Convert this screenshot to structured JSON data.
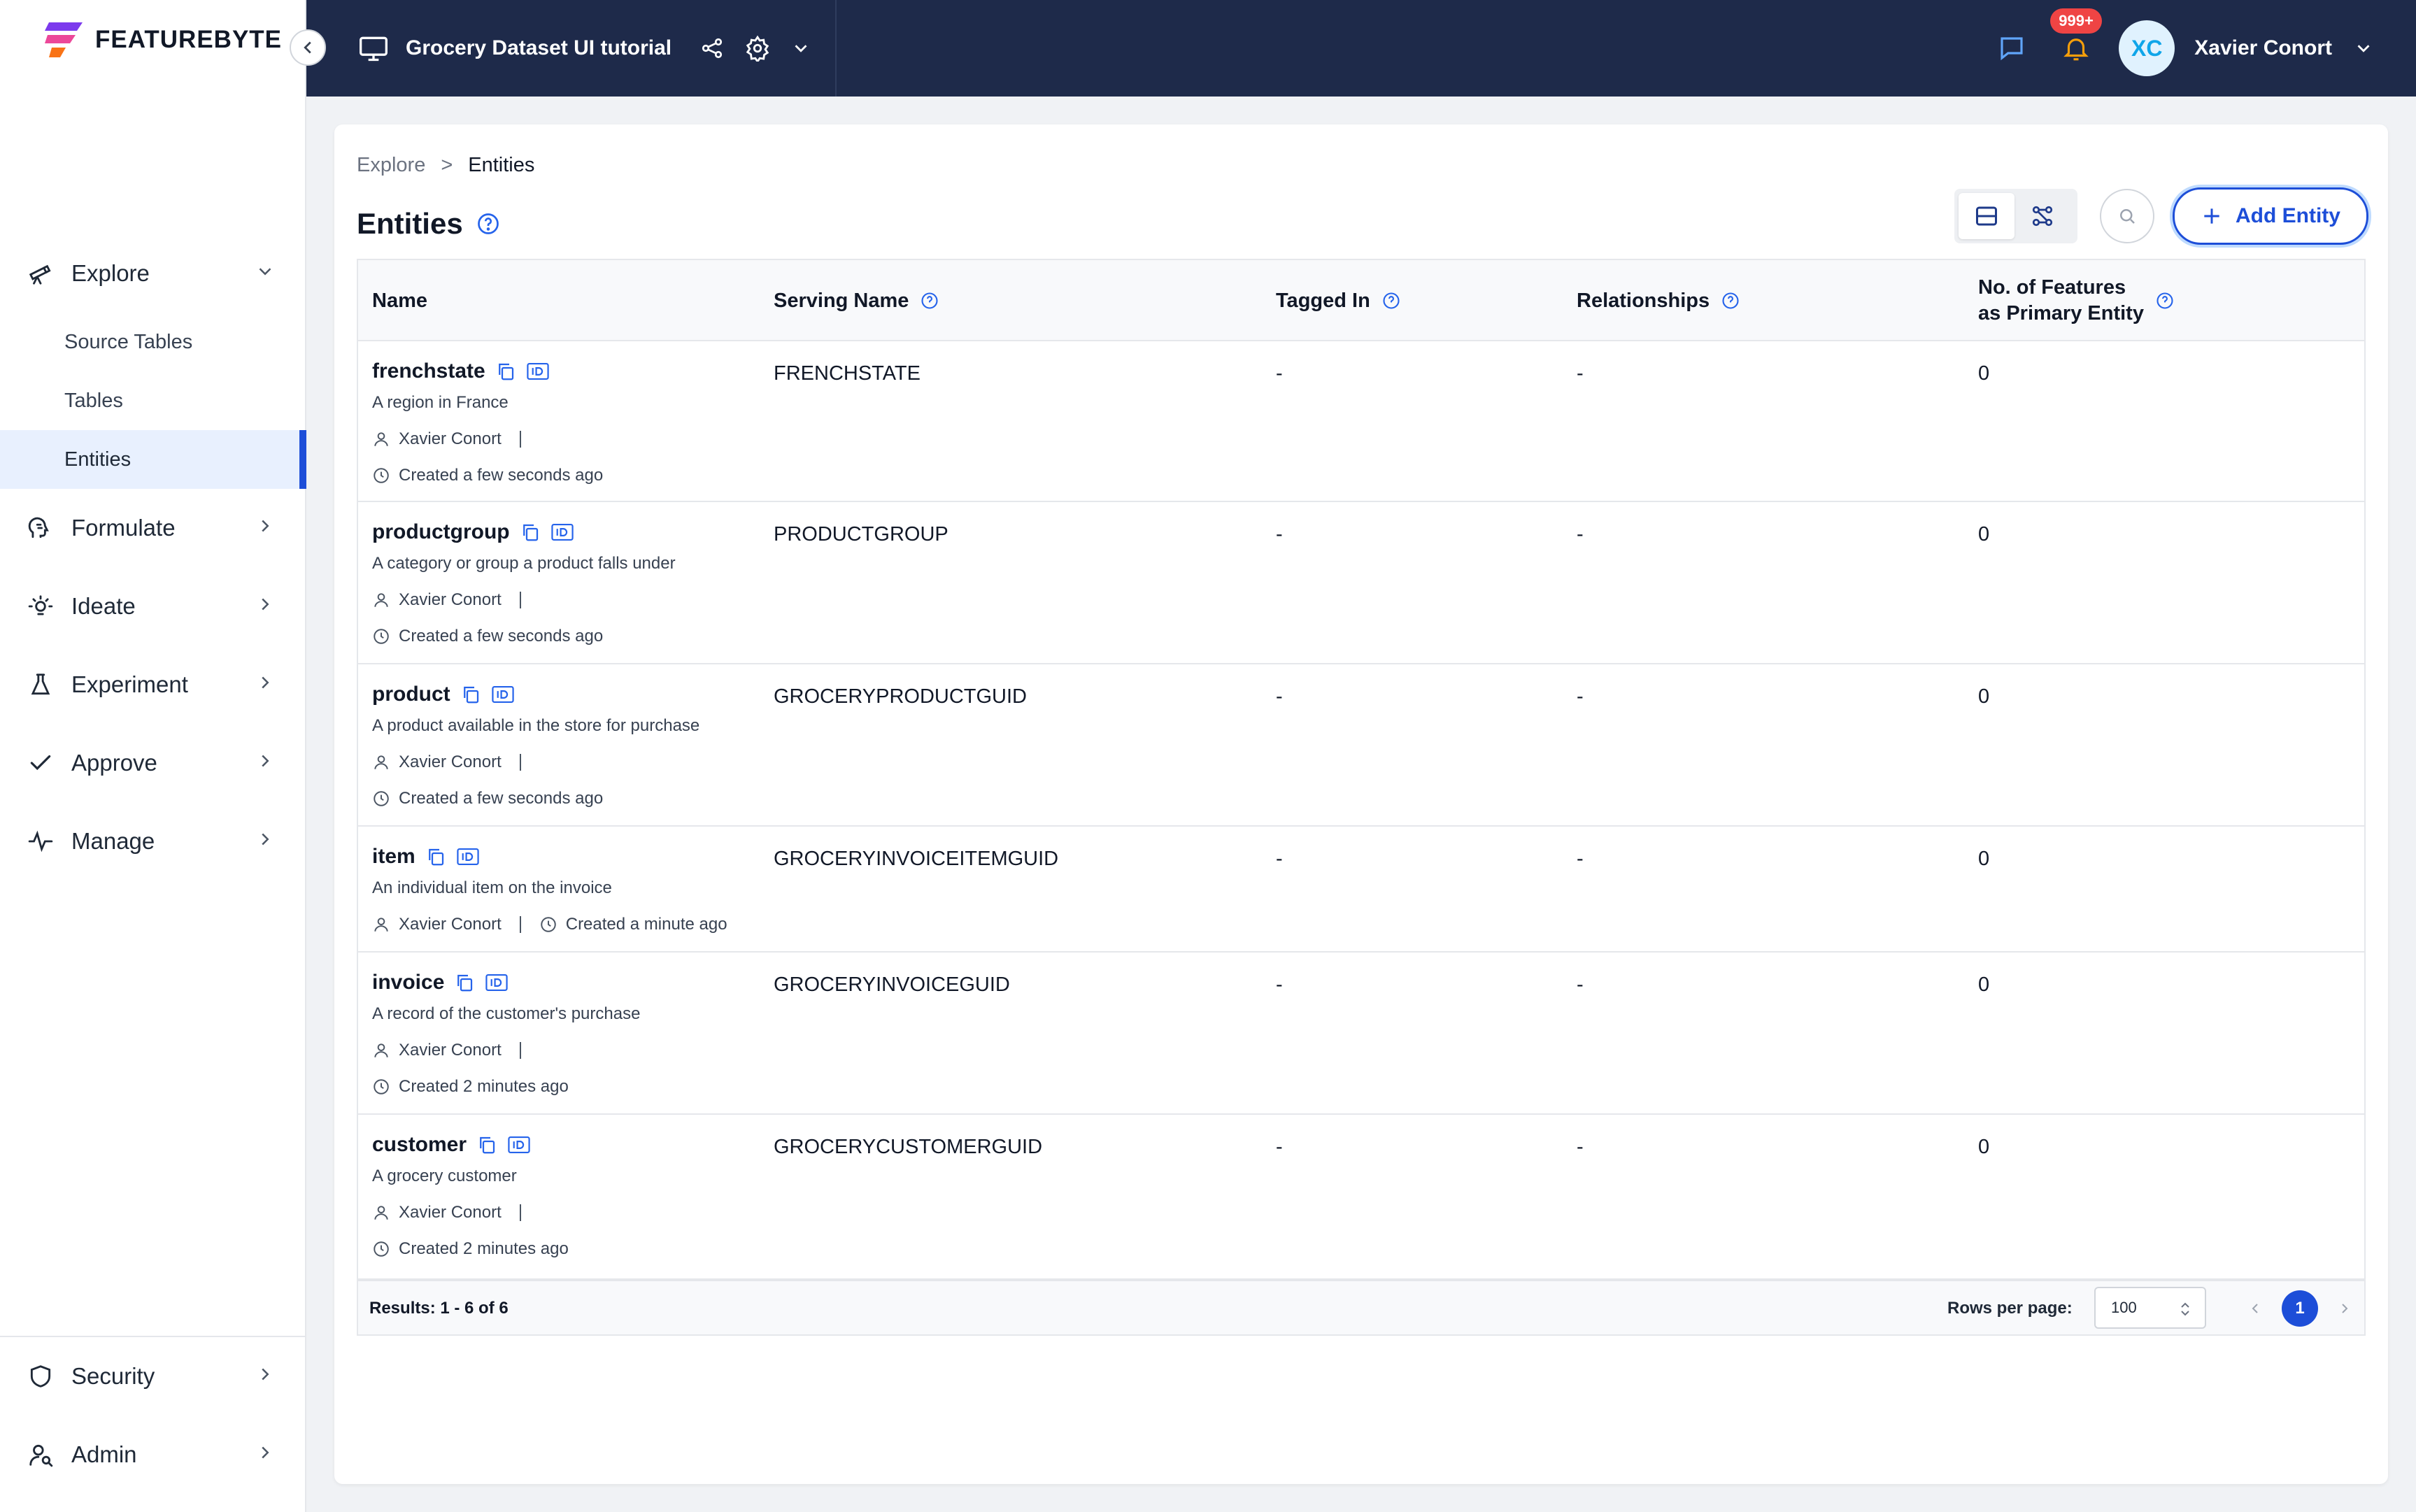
{
  "brand": {
    "name": "FEATUREBYTE"
  },
  "sidebar": {
    "explore": {
      "label": "Explore",
      "sub_items": [
        "Source Tables",
        "Tables",
        "Entities"
      ]
    },
    "items": [
      "Formulate",
      "Ideate",
      "Experiment",
      "Approve",
      "Manage"
    ],
    "bottom_items": [
      "Security",
      "Admin"
    ]
  },
  "header": {
    "project_name": "Grocery Dataset UI tutorial",
    "notification_badge": "999+",
    "avatar_initials": "XC",
    "user_name": "Xavier Conort"
  },
  "breadcrumb": {
    "parent": "Explore",
    "separator": ">",
    "current": "Entities"
  },
  "page": {
    "title": "Entities",
    "add_button_label": "Add Entity"
  },
  "table": {
    "columns": {
      "name": "Name",
      "serving_name": "Serving Name",
      "tagged_in": "Tagged In",
      "relationships": "Relationships",
      "features_line1": "No. of Features",
      "features_line2": "as Primary Entity"
    },
    "rows": [
      {
        "name": "frenchstate",
        "description": "A region in France",
        "author": "Xavier Conort",
        "created": "Created a few seconds ago",
        "serving_name": "FRENCHSTATE",
        "tagged_in": "-",
        "relationships": "-",
        "features": "0"
      },
      {
        "name": "productgroup",
        "description": "A category or group a product falls under",
        "author": "Xavier Conort",
        "created": "Created a few seconds ago",
        "serving_name": "PRODUCTGROUP",
        "tagged_in": "-",
        "relationships": "-",
        "features": "0"
      },
      {
        "name": "product",
        "description": "A product available in the store for purchase",
        "author": "Xavier Conort",
        "created": "Created a few seconds ago",
        "serving_name": "GROCERYPRODUCTGUID",
        "tagged_in": "-",
        "relationships": "-",
        "features": "0"
      },
      {
        "name": "item",
        "description": "An individual item on the invoice",
        "author": "Xavier Conort",
        "created": "Created a minute ago",
        "serving_name": "GROCERYINVOICEITEMGUID",
        "tagged_in": "-",
        "relationships": "-",
        "features": "0"
      },
      {
        "name": "invoice",
        "description": "A record of the customer's purchase",
        "author": "Xavier Conort",
        "created": "Created 2 minutes ago",
        "serving_name": "GROCERYINVOICEGUID",
        "tagged_in": "-",
        "relationships": "-",
        "features": "0"
      },
      {
        "name": "customer",
        "description": "A grocery customer",
        "author": "Xavier Conort",
        "created": "Created 2 minutes ago",
        "serving_name": "GROCERYCUSTOMERGUID",
        "tagged_in": "-",
        "relationships": "-",
        "features": "0"
      }
    ],
    "footer": {
      "results": "Results: 1 - 6 of 6",
      "rows_per_page_label": "Rows per page:",
      "rows_per_page_value": "100",
      "current_page": "1"
    }
  },
  "colors": {
    "header_bg": "#1e2a4a",
    "accent": "#1d4ed8",
    "badge": "#ef4444",
    "active_nav_bg": "#e8f0fe"
  }
}
